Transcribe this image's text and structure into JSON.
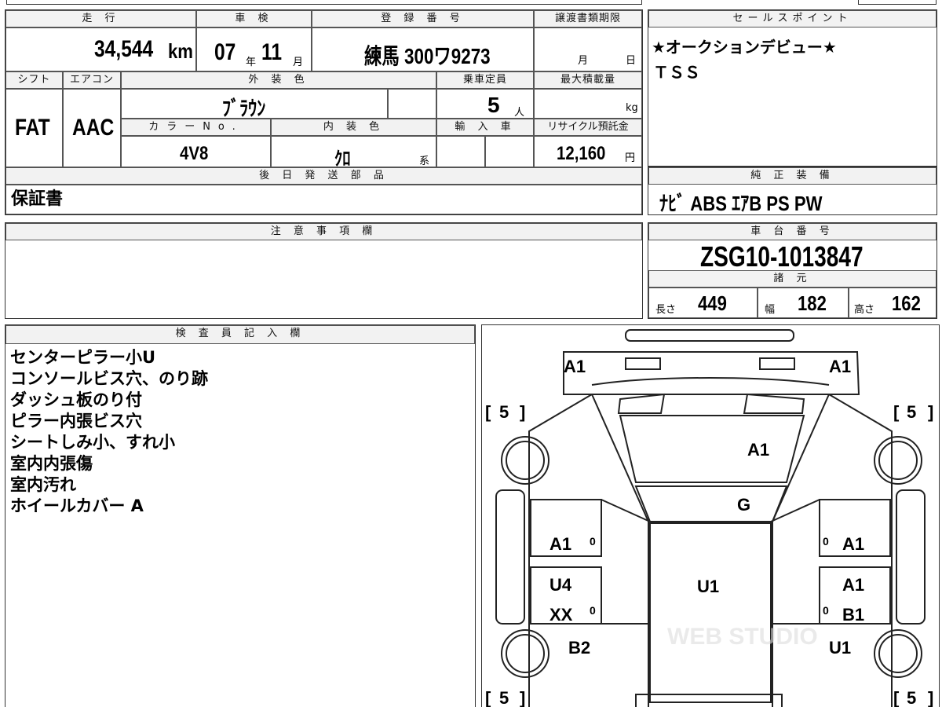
{
  "vehicle": {
    "mileage_label": "走 行",
    "mileage_value": "34,544",
    "mileage_unit": "km",
    "inspection_label": "車 検",
    "inspection_year": "07",
    "inspection_year_unit": "年",
    "inspection_month": "11",
    "inspection_month_unit": "月",
    "registration_label": "登 録 番 号",
    "registration_value": "練馬 300ワ9273",
    "transfer_label": "譲渡書類期限",
    "transfer_month_unit": "月",
    "transfer_day_unit": "日",
    "shift_label": "シフト",
    "shift_value": "FAT",
    "aircon_label": "エアコン",
    "aircon_value": "AAC",
    "exterior_color_label": "外 装 色",
    "exterior_color_value": "ﾌﾞﾗｳﾝ",
    "capacity_label": "乗車定員",
    "capacity_value": "5",
    "capacity_unit": "人",
    "max_load_label": "最大積載量",
    "max_load_unit": "kg",
    "color_no_label": "カラーNo.",
    "color_no_value": "4V8",
    "interior_color_label": "内 装 色",
    "interior_color_value": "ｸﾛ",
    "interior_color_unit": "系",
    "import_label": "輸 入 車",
    "recycle_label": "リサイクル預託金",
    "recycle_value": "12,160",
    "recycle_unit": "円",
    "later_parts_label": "後 日 発 送 部 品",
    "later_parts_value": "保証書"
  },
  "sales_point": {
    "label": "セールスポイント",
    "lines": [
      "★オークションデビュー★",
      "ＴＳＳ"
    ]
  },
  "equipment": {
    "label": "純 正 装 備",
    "value": "ﾅﾋﾞ ABS ｴｱB PS PW"
  },
  "notes": {
    "label": "注 意 事 項 欄"
  },
  "chassis": {
    "label": "車 台 番 号",
    "value": "ZSG10-1013847",
    "specs_label": "諸 元",
    "length_label": "長さ",
    "length_value": "449",
    "width_label": "幅",
    "width_value": "182",
    "height_label": "高さ",
    "height_value": "162"
  },
  "inspector": {
    "label": "検 査 員 記 入 欄",
    "lines": [
      "センターピラー小U",
      "コンソールビス穴、のり跡",
      "ダッシュ板のり付",
      "ピラー内張ビス穴",
      "シートしみ小、すれ小",
      "室内内張傷",
      "室内汚れ",
      "ホイールカバー A"
    ]
  },
  "diagram": {
    "bracket_left": "[",
    "bracket_right": "]",
    "tire_score": "5",
    "zero": "0",
    "marks": {
      "front_left": "A1",
      "front_right": "A1",
      "hood": "A1",
      "windshield": "G",
      "left_front_door": "A1",
      "right_front_door": "A1",
      "roof": "U1",
      "left_rear_door_top": "U4",
      "left_rear_door_bottom": "XX",
      "right_rear_door_top": "A1",
      "right_rear_door_bottom": "B1",
      "left_rear_fender": "B2",
      "right_rear_fender": "U1"
    },
    "watermark": "WEB STUDIO"
  }
}
